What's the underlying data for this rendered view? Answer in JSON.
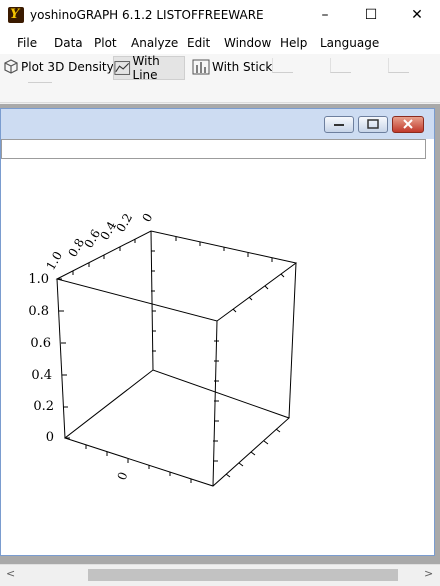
{
  "window": {
    "title": "yoshinoGRAPH 6.1.2  LISTOFFREEWARE",
    "app_icon": "yoshinograph-logo-icon"
  },
  "titlebar_buttons": {
    "minimize": "–",
    "maximize": "☐",
    "close": "✕"
  },
  "menu": [
    "File",
    "Data",
    "Plot",
    "Analyze",
    "Edit",
    "Window",
    "Help",
    "Language"
  ],
  "toolbar": {
    "plot3d_label": "Plot 3D Density",
    "withline_label": "With Line",
    "withstick_label": "With Stick"
  },
  "plot": {
    "z_ticks": [
      "1.0",
      "0.8",
      "0.6",
      "0.4",
      "0.2",
      "0"
    ],
    "y_ticks": [
      "0",
      "0.2",
      "0.4",
      "0.6",
      "0.8",
      "1.0"
    ],
    "x_ticks": [
      "0"
    ]
  },
  "scroll": {
    "left": "<",
    "right": ">"
  }
}
